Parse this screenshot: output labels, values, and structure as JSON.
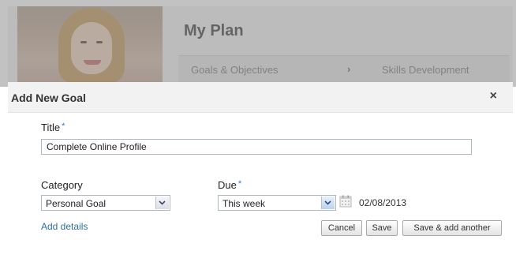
{
  "background": {
    "plan_title": "My Plan",
    "tabs": [
      {
        "label": "Goals & Objectives"
      },
      {
        "label": "Skills Development"
      }
    ],
    "tab_separator": "›"
  },
  "dialog": {
    "title": "Add New Goal",
    "close_icon": "×",
    "title_field": {
      "label": "Title",
      "required_mark": "*",
      "value": "Complete Online Profile"
    },
    "category_field": {
      "label": "Category",
      "selected": "Personal Goal"
    },
    "due_field": {
      "label": "Due",
      "required_mark": "*",
      "selected": "This week",
      "date": "02/08/2013"
    },
    "add_details_link": "Add details",
    "buttons": {
      "cancel": "Cancel",
      "save": "Save",
      "save_add_another": "Save & add another"
    }
  },
  "colors": {
    "link": "#2f6fa8",
    "required": "#3a7bbf",
    "header_bg": "#f2f2f2"
  },
  "icons": {
    "close": "close-icon",
    "dropdown": "chevron-down-icon",
    "calendar": "calendar-icon"
  }
}
